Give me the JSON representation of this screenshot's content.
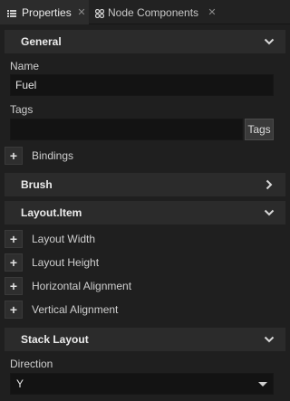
{
  "tabs": [
    {
      "label": "Properties",
      "icon": "list-icon",
      "active": true
    },
    {
      "label": "Node Components",
      "icon": "components-icon",
      "active": false
    }
  ],
  "sections": {
    "general": {
      "title": "General",
      "expanded": true
    },
    "brush": {
      "title": "Brush",
      "expanded": false
    },
    "layout_item": {
      "title": "Layout.Item",
      "expanded": true
    },
    "stack_layout": {
      "title": "Stack Layout",
      "expanded": true
    }
  },
  "general": {
    "name_label": "Name",
    "name_value": "Fuel",
    "tags_label": "Tags",
    "tags_value": "",
    "tags_button": "Tags",
    "bindings_label": "Bindings"
  },
  "layout_item": {
    "properties": [
      "Layout Width",
      "Layout Height",
      "Horizontal Alignment",
      "Vertical Alignment"
    ]
  },
  "stack_layout": {
    "direction_label": "Direction",
    "direction_value": "Y"
  },
  "colors": {
    "background": "#1f1f1f",
    "section_header": "#2b2b2b",
    "input_bg": "#131313",
    "text": "#d4d4d4"
  }
}
